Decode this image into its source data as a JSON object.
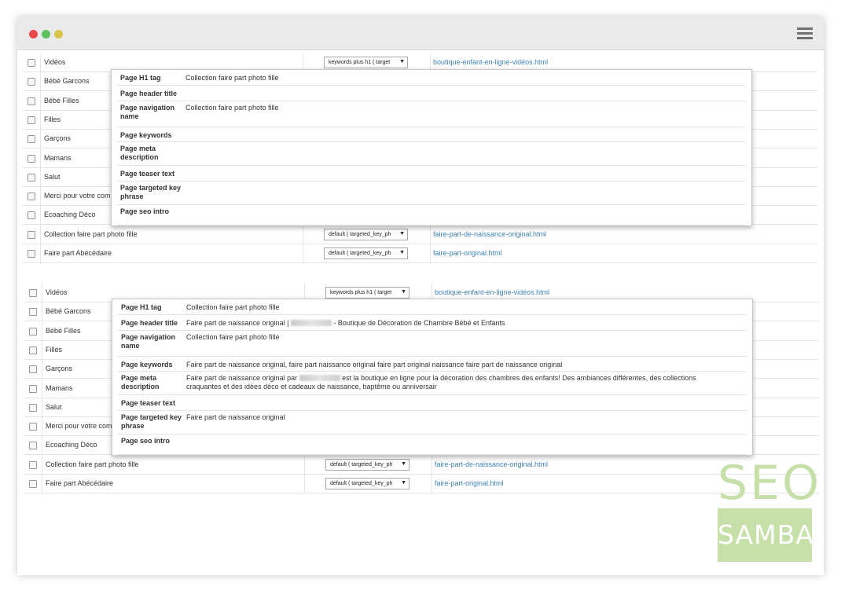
{
  "window": {
    "menu_icon": "hamburger-menu-icon",
    "traffic_lights": [
      "#e8484a",
      "#5dc15e",
      "#d8c24a"
    ]
  },
  "sections": [
    {
      "rows": [
        {
          "name": "Vidéos",
          "select": "keywords plus h1 ( target",
          "url": "boutique-enfant-en-ligne-vidéos.html"
        },
        {
          "name": "Bébé Garcons"
        },
        {
          "name": "Bébé Filles"
        },
        {
          "name": "Filles"
        },
        {
          "name": "Garçons"
        },
        {
          "name": "Mamans"
        },
        {
          "name": "Salut"
        },
        {
          "name": "Merci pour votre com"
        },
        {
          "name": "Ecoaching Déco"
        },
        {
          "name": "Collection faire part photo fille",
          "select": "default ( targeted_key_ph",
          "url": "faire-part-de-naissance-original.html"
        },
        {
          "name": "Faire part Abécédaire",
          "select": "default ( targeted_key_ph",
          "url": "faire-part-original.html"
        }
      ],
      "popup": [
        {
          "label": "Page H1 tag",
          "value": "Collection faire part photo fille"
        },
        {
          "label": "Page header title",
          "value": ""
        },
        {
          "label": "Page navigation name",
          "value": "Collection faire part photo fille"
        },
        {
          "label": "Page keywords",
          "value": ""
        },
        {
          "label": "Page meta description",
          "value": ""
        },
        {
          "label": "Page teaser text",
          "value": ""
        },
        {
          "label": "Page targeted key phrase",
          "value": ""
        },
        {
          "label": "Page seo intro",
          "value": ""
        }
      ]
    },
    {
      "rows": [
        {
          "name": "Vidéos",
          "select": "keywords plus h1 ( target",
          "url": "boutique-enfant-en-ligne-vidéos.html"
        },
        {
          "name": "Bébé Garcons"
        },
        {
          "name": "Bébé Filles"
        },
        {
          "name": "Filles"
        },
        {
          "name": "Garçons"
        },
        {
          "name": "Mamans"
        },
        {
          "name": "Salut"
        },
        {
          "name": "Merci pour votre com"
        },
        {
          "name": "Ecoaching Déco"
        },
        {
          "name": "Collection faire part photo fille",
          "select": "default ( targeted_key_ph",
          "url": "faire-part-de-naissance-original.html"
        },
        {
          "name": "Faire part Abécédaire",
          "select": "default ( targeted_key_ph",
          "url": "faire-part-original.html"
        }
      ],
      "popup": [
        {
          "label": "Page H1 tag",
          "value": "Collection faire part photo fille"
        },
        {
          "label": "Page header title",
          "value_pre": "Faire part de naissance original | ",
          "value_post": " - Boutique de Décoration de Chambre Bébé et Enfants"
        },
        {
          "label": "Page navigation name",
          "value": "Collection faire part photo fille"
        },
        {
          "label": "Page keywords",
          "value": "Faire part de naissance original, faire part naissance original faire part original naissance faire part de naissance original"
        },
        {
          "label": "Page meta description",
          "value_pre": "Faire part de naissance original par ",
          "value_post": " est la boutique en ligne pour la décoration des chambres des enfants! Des ambiances différentes, des collections",
          "value_line2": "craquantes et des idées déco et cadeaux de naissance, baptême ou anniversair"
        },
        {
          "label": "Page teaser text",
          "value": ""
        },
        {
          "label": "Page targeted key phrase",
          "value": "Faire part de naissance original"
        },
        {
          "label": "Page seo intro",
          "value": ""
        }
      ]
    }
  ],
  "logo": {
    "top": "SEO",
    "bottom": "SAMBA",
    "color": "#c7e0a9"
  }
}
